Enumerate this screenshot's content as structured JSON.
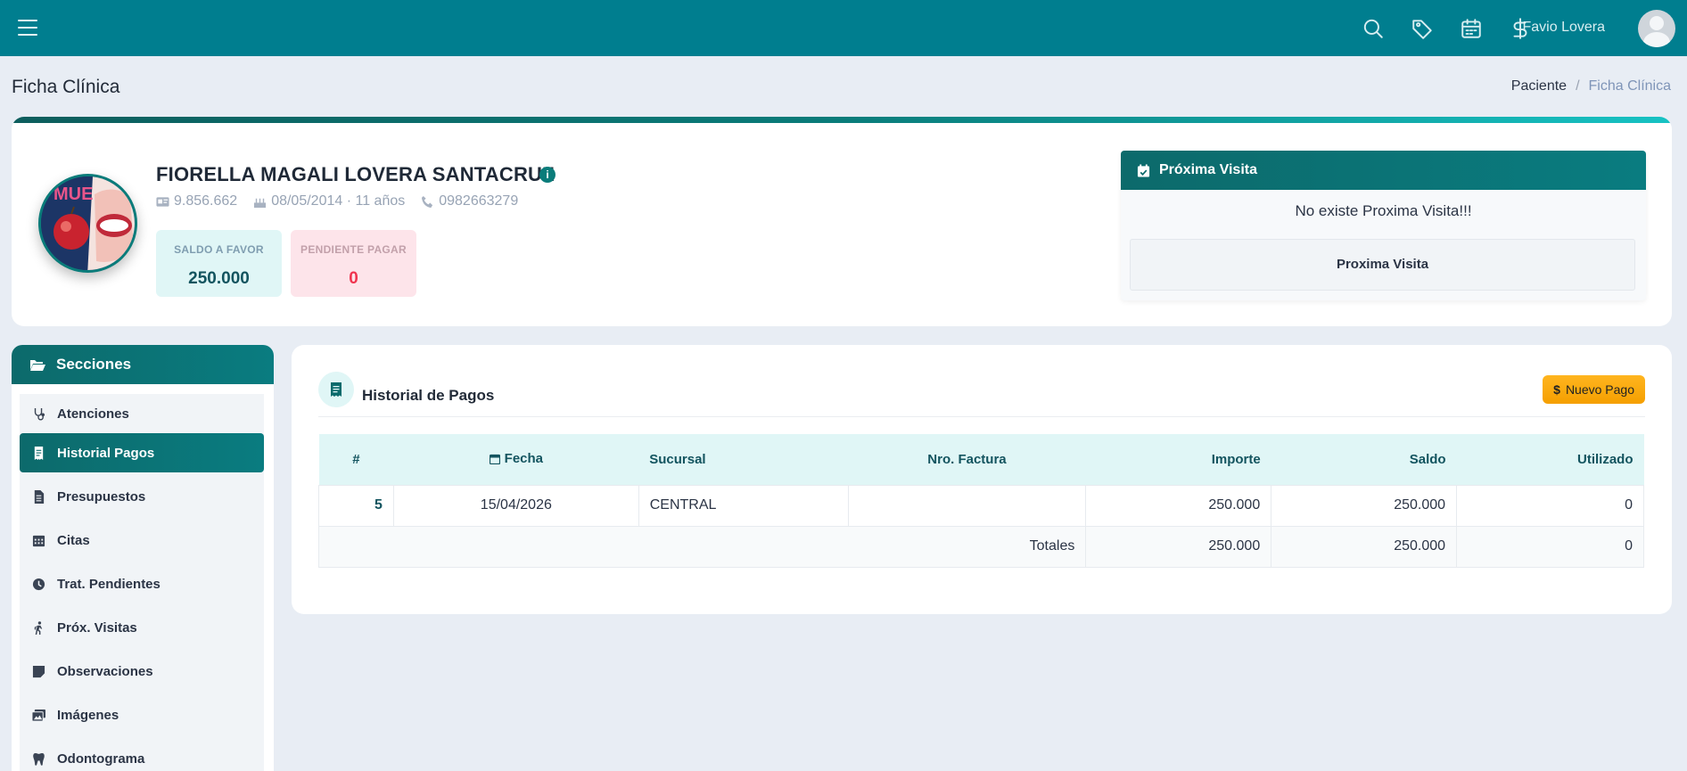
{
  "topbar": {
    "user_name": "Favio Lovera",
    "icons": [
      "menu-icon",
      "search-icon",
      "tag-icon",
      "calendar-icon",
      "dollar-icon"
    ]
  },
  "page": {
    "title": "Ficha Clínica",
    "breadcrumb": [
      "Paciente",
      "Ficha Clínica"
    ]
  },
  "patient": {
    "name": "FIORELLA MAGALI LOVERA SANTACRUZ",
    "ci": "9.856.662",
    "birth": "08/05/2014 · 11 años",
    "phone": "0982663279",
    "saldo_favor_label": "SALDO A FAVOR",
    "saldo_favor_value": "250.000",
    "pendiente_label": "PENDIENTE PAGAR",
    "pendiente_value": "0"
  },
  "proxima": {
    "title": "Próxima Visita",
    "message": "No existe Proxima Visita!!!",
    "button": "Proxima Visita"
  },
  "sidebar": {
    "title": "Secciones",
    "items": [
      {
        "label": "Atenciones",
        "icon": "stethoscope-icon"
      },
      {
        "label": "Historial Pagos",
        "icon": "receipt-icon"
      },
      {
        "label": "Presupuestos",
        "icon": "file-invoice-icon"
      },
      {
        "label": "Citas",
        "icon": "calendar-icon"
      },
      {
        "label": "Trat. Pendientes",
        "icon": "clock-icon"
      },
      {
        "label": "Próx. Visitas",
        "icon": "walking-icon"
      },
      {
        "label": "Observaciones",
        "icon": "sticky-note-icon"
      },
      {
        "label": "Imágenes",
        "icon": "images-icon"
      },
      {
        "label": "Odontograma",
        "icon": "tooth-icon"
      }
    ],
    "active_index": 1
  },
  "historial": {
    "title": "Historial de Pagos",
    "new_button": "Nuevo Pago",
    "columns": [
      "#",
      "Fecha",
      "Sucursal",
      "Nro. Factura",
      "Importe",
      "Saldo",
      "Utilizado"
    ],
    "rows": [
      {
        "num": "5",
        "fecha": "15/04/2026",
        "sucursal": "CENTRAL",
        "factura": "",
        "importe": "250.000",
        "saldo": "250.000",
        "utilizado": "0"
      }
    ],
    "totals": {
      "label": "Totales",
      "importe": "250.000",
      "saldo": "250.000",
      "utilizado": "0"
    }
  },
  "colors": {
    "topbar": "#007e8f",
    "accent": "#0a7c7a",
    "warning": "#ffb51f",
    "danger": "#f0344f"
  }
}
